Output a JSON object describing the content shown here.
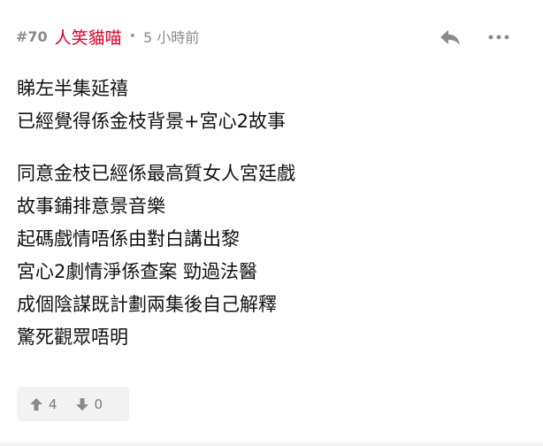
{
  "post": {
    "number": "#70",
    "username": "人笑貓喵",
    "separator": "•",
    "time_ago": "5 小時前",
    "reply_icon": "reply-icon",
    "more_icon": "more-icon"
  },
  "content": {
    "paragraph1": [
      "睇左半集延禧",
      "已經覺得係金枝背景+宮心2故事"
    ],
    "paragraph2": [
      "同意金枝已經係最高質女人宮廷戲",
      "故事鋪排意景音樂",
      "起碼戲情唔係由對白講出黎",
      "宮心2劇情淨係查案 勁過法醫",
      "成個陰謀既計劃兩集後自己解釋",
      "驚死觀眾唔明"
    ]
  },
  "votes": {
    "upvote_count": "4",
    "downvote_count": "0",
    "upvote_icon": "arrow-up-icon",
    "downvote_icon": "arrow-down-icon"
  },
  "colors": {
    "username": "#e0002a",
    "meta": "#8a8a8a",
    "text": "#111111",
    "vote_bg": "#f2f2f2"
  }
}
